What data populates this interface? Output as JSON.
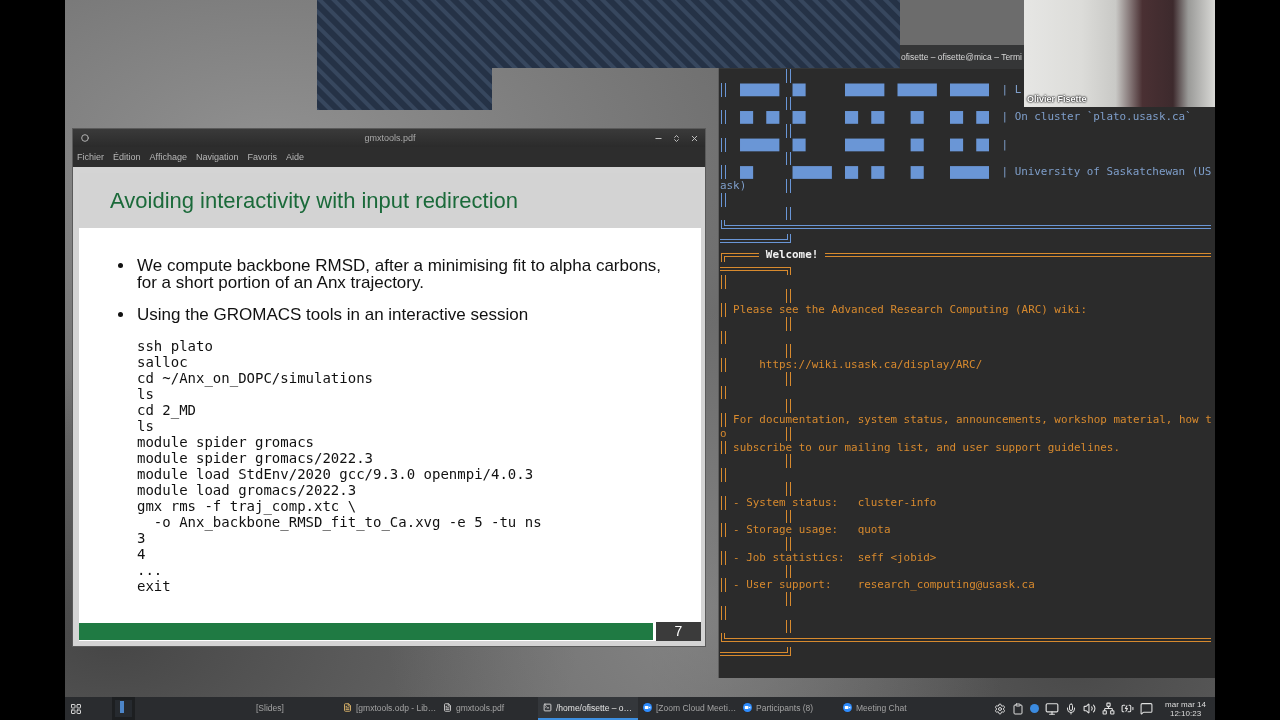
{
  "pdf_viewer": {
    "title": "gmxtools.pdf",
    "menu": [
      "Fichier",
      "Édition",
      "Affichage",
      "Navigation",
      "Favoris",
      "Aide"
    ],
    "slide": {
      "title": "Avoiding interactivity with input redirection",
      "bullets": [
        "We compute backbone RMSD, after a minimising fit to alpha carbons, for a short portion of an Anx trajectory.",
        "Using the GROMACS tools in an interactive session"
      ],
      "code_lines": [
        "ssh plato",
        "salloc",
        "cd ~/Anx_on_DOPC/simulations",
        "ls",
        "cd 2_MD",
        "ls",
        "module spider gromacs",
        "module spider gromacs/2022.3",
        "module load StdEnv/2020 gcc/9.3.0 openmpi/4.0.3",
        "module load gromacs/2022.3",
        "gmx rms -f traj_comp.xtc \\",
        "  -o Anx_backbone_RMSD_fit_to_Ca.xvg -e 5 -tu ns",
        "3",
        "4",
        "...",
        "exit"
      ],
      "page_number": "7"
    }
  },
  "terminal": {
    "title": "ofisette – ofisette@mica – Termi",
    "banner_lines": [
      {
        "kind": "line",
        "text": "| L"
      },
      {
        "kind": "line",
        "text": "| On cluster `plato.usask.ca`"
      },
      {
        "kind": "line",
        "text": "|"
      },
      {
        "kind": "line",
        "text": "| University of Saskatchewan (US"
      },
      {
        "kind": "wrap",
        "text": "ask)"
      },
      {
        "kind": "blank"
      }
    ],
    "welcome_title": "Welcome!",
    "message_lines": [
      {
        "kind": "blank"
      },
      {
        "kind": "text",
        "text": "Please see the Advanced Research Computing (ARC) wiki:"
      },
      {
        "kind": "blank"
      },
      {
        "kind": "url",
        "text": "https://wiki.usask.ca/display/ARC/"
      },
      {
        "kind": "blank"
      },
      {
        "kind": "text",
        "text": "For documentation, system status, announcements, workshop material, how t"
      },
      {
        "kind": "wrap",
        "text": "o"
      },
      {
        "kind": "text",
        "text": "subscribe to our mailing list, and user support guidelines."
      },
      {
        "kind": "blank"
      },
      {
        "kind": "text",
        "text": "- System status:   cluster-info"
      },
      {
        "kind": "text",
        "text": "- Storage usage:   quota"
      },
      {
        "kind": "text",
        "text": "- Job statistics:  seff <jobid>"
      },
      {
        "kind": "text",
        "text": "- User support:    research_computing@usask.ca"
      },
      {
        "kind": "blank"
      }
    ]
  },
  "video_tile": {
    "participant_name": "Olivier Fisette"
  },
  "taskbar": {
    "tasks": [
      {
        "kind": "plain",
        "label": "[Slides]",
        "selected": false
      },
      {
        "kind": "document",
        "label": "[gmxtools.odp - Lib…",
        "selected": false
      },
      {
        "kind": "pdf",
        "label": "gmxtools.pdf",
        "selected": false
      },
      {
        "kind": "terminal",
        "label": "/home/ofisette – o…",
        "selected": true
      },
      {
        "kind": "zoom",
        "label": "[Zoom Cloud Meeti…",
        "selected": false
      },
      {
        "kind": "zoom",
        "label": "Participants (8)",
        "selected": false
      },
      {
        "kind": "zoom",
        "label": "Meeting Chat",
        "selected": false
      }
    ],
    "clock": {
      "date": "mar mar 14",
      "time": "12:10:23"
    }
  }
}
